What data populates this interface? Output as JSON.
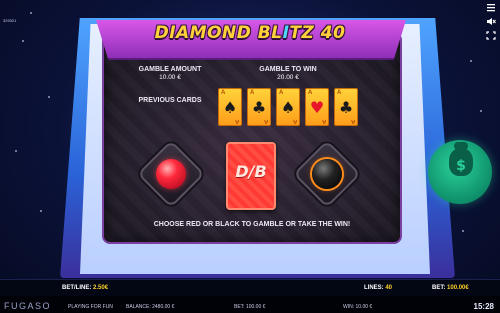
{
  "version": "329321",
  "title": "DIAMOND BLITZ 40",
  "gamble": {
    "amount_label": "GAMBLE AMOUNT",
    "amount_value": "10.00 €",
    "to_win_label": "GAMBLE TO WIN",
    "to_win_value": "20.00 €",
    "previous_label": "PREVIOUS CARDS",
    "previous_cards": [
      {
        "rank": "A",
        "suit": "♠",
        "color": "#1a1a1a"
      },
      {
        "rank": "A",
        "suit": "♣",
        "color": "#1a1a1a"
      },
      {
        "rank": "A",
        "suit": "♠",
        "color": "#1a1a1a"
      },
      {
        "rank": "A",
        "suit": "♥",
        "color": "#e8142a"
      },
      {
        "rank": "A",
        "suit": "♣",
        "color": "#1a1a1a"
      }
    ],
    "deck_mark": "D/B",
    "instruction": "CHOOSE RED OR BLACK TO GAMBLE OR TAKE THE WIN!"
  },
  "hud": {
    "bet_line_label": "BET/LINE:",
    "bet_line_value": "2.50€",
    "lines_label": "LINES:",
    "lines_value": "40",
    "bet_label": "BET:",
    "bet_value": "100.00€"
  },
  "footer": {
    "brand": "FUGASO",
    "mode": "PLAYING FOR FUN",
    "balance": "BALANCE: 2480.00 €",
    "bet": "BET: 100.00 €",
    "win": "WIN: 10.00 €",
    "time": "15:28"
  },
  "icons": {
    "collect": "money-bag-icon",
    "sound": "speaker-mute-icon",
    "fullscreen": "fullscreen-icon",
    "menu": "menu-icon"
  },
  "colors": {
    "red_button": "#ff2a3c",
    "black_button": "#111111",
    "collect": "#12a87c",
    "accent": "#ffd22a"
  }
}
